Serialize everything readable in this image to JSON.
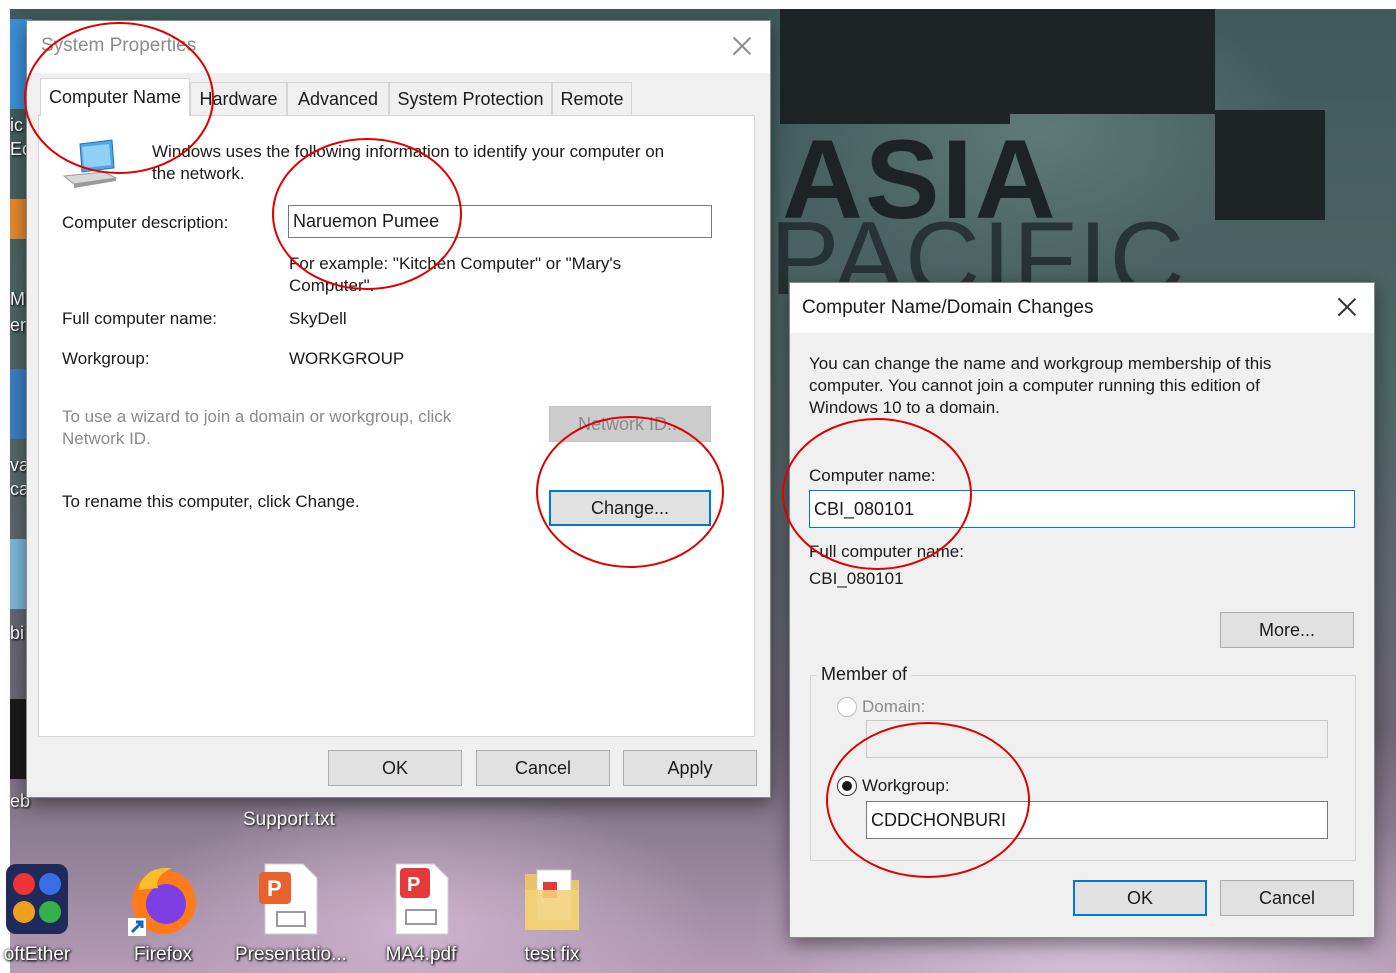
{
  "desktop": {
    "poster_words": [
      "ASIA",
      "PACIFIC"
    ],
    "left_fragments": [
      "ic",
      "Ec",
      "M",
      "en",
      "va",
      "ca",
      "bi",
      "eb"
    ],
    "icons": [
      {
        "label": "oftEther",
        "icon": "softether-icon"
      },
      {
        "label": "Firefox",
        "icon": "firefox-icon"
      },
      {
        "label": "Presentatio...",
        "icon": "presentation-file-icon"
      },
      {
        "label": "MA4.pdf",
        "icon": "pdf-file-icon"
      },
      {
        "label": "test fix",
        "icon": "folder-icon"
      }
    ],
    "hidden_labels": [
      "Support.txt"
    ]
  },
  "system_properties": {
    "title": "System Properties",
    "tabs": [
      "Computer Name",
      "Hardware",
      "Advanced",
      "System Protection",
      "Remote"
    ],
    "selected_tab": "Computer Name",
    "intro": "Windows uses the following information to identify your computer on the network.",
    "intro_line1": "Windows uses the following information to identify your computer on",
    "intro_line2": "the network.",
    "description_label": "Computer description:",
    "description_value": "Naruemon Pumee",
    "example_line1": "For example: \"Kitchen Computer\" or \"Mary's",
    "example_line2": "Computer\".",
    "full_name_label": "Full computer name:",
    "full_name_value": "SkyDell",
    "workgroup_label": "Workgroup:",
    "workgroup_value": "WORKGROUP",
    "network_text_line1": "To use a wizard to join a domain or workgroup, click",
    "network_text_line2": "Network ID.",
    "network_id_button": "Network ID...",
    "rename_text": "To rename this computer, click Change.",
    "change_button": "Change...",
    "ok_button": "OK",
    "cancel_button": "Cancel",
    "apply_button": "Apply"
  },
  "domain_changes": {
    "title": "Computer Name/Domain Changes",
    "intro_line1": "You can change the name and workgroup membership of this",
    "intro_line2": "computer. You cannot join a computer running this edition of",
    "intro_line3": "Windows 10 to a domain.",
    "computer_name_label": "Computer name:",
    "computer_name_value": "CBI_080101",
    "full_name_label": "Full computer name:",
    "full_name_value": "CBI_080101",
    "more_button": "More...",
    "member_of_label": "Member of",
    "domain_label": "Domain:",
    "domain_value": "",
    "workgroup_label": "Workgroup:",
    "workgroup_value": "CDDCHONBURI",
    "selected_membership": "Workgroup",
    "ok_button": "OK",
    "cancel_button": "Cancel"
  },
  "colors": {
    "annotation": "#e00000",
    "focus_blue": "#0078d7",
    "dialog_bg": "#f0f0f0"
  }
}
